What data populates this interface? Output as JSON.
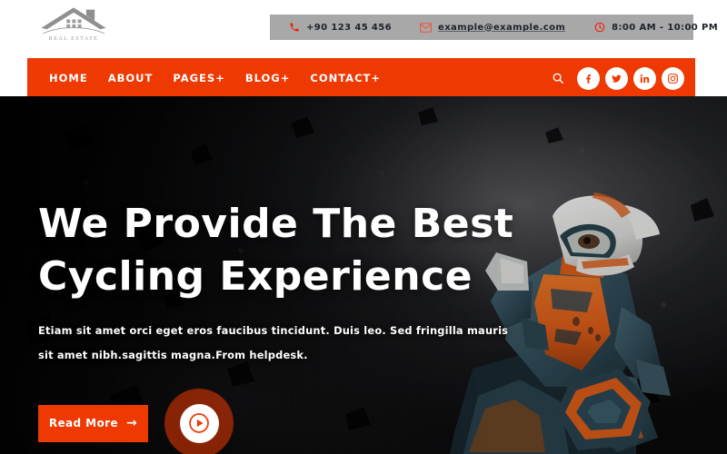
{
  "brand": {
    "logo_icon": "house-roof-icon",
    "logo_text": "REAL ESTATE"
  },
  "topbar": {
    "background_color": "#a8a8a8",
    "phone": {
      "icon": "phone-icon",
      "text": "+90 123 45 456"
    },
    "email": {
      "icon": "envelope-icon",
      "text": "example@example.com"
    },
    "hours": {
      "icon": "clock-icon",
      "text": "8:00 AM - 10:00 PM"
    }
  },
  "nav": {
    "accent_color": "#ee3902",
    "items": [
      {
        "label": "HOME"
      },
      {
        "label": "ABOUT"
      },
      {
        "label": "PAGES+"
      },
      {
        "label": "BLOG+"
      },
      {
        "label": "CONTACT+"
      }
    ],
    "search_icon": "search-icon",
    "socials": [
      {
        "name": "facebook-icon"
      },
      {
        "name": "twitter-icon"
      },
      {
        "name": "linkedin-icon"
      },
      {
        "name": "instagram-icon"
      }
    ]
  },
  "hero": {
    "title_line_1": "We Provide The Best",
    "title_line_2": "Cycling Experience",
    "description": "Etiam sit amet orci eget eros faucibus tincidunt. Duis leo. Sed fringilla mauris sit amet nibh.sagittis magna.From helpdesk.",
    "read_more_label": "Read More",
    "read_more_arrow": "→",
    "play_icon": "play-circle-icon",
    "image_subject": "motocross-rider-dark-background"
  }
}
